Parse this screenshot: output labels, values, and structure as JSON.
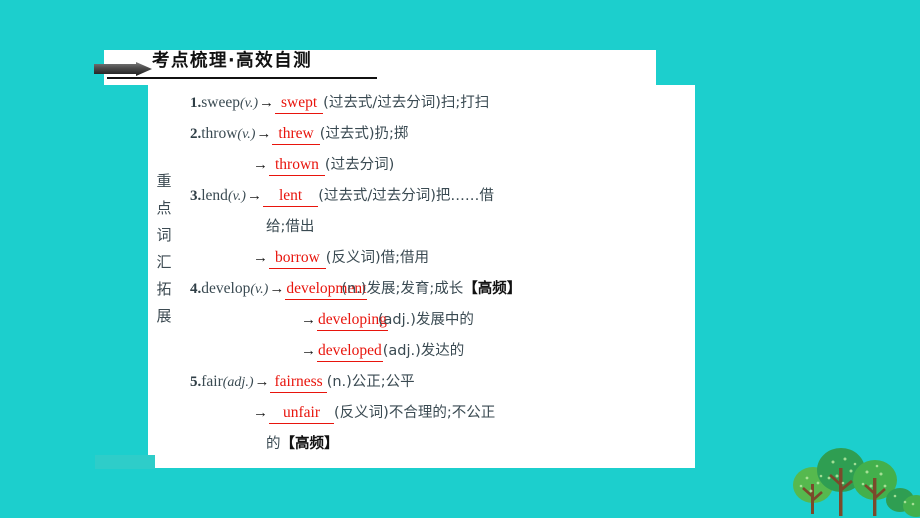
{
  "theme": {
    "teal": "#1ccfcd",
    "red": "#e8140c",
    "ink": "#3a4a52",
    "white": "#ffffff"
  },
  "header": {
    "title": "考点梳理·高效自测",
    "arrow_icon": "arrow-right-icon"
  },
  "sidebar": {
    "vertical_label": "重点词汇拓展",
    "chars": [
      "重",
      "点",
      "词",
      "汇",
      "拓",
      "展"
    ]
  },
  "entries": [
    {
      "num": "1.",
      "word": "sweep",
      "pos": "(v.)",
      "arrow": "→",
      "answer": "swept",
      "gloss": "(过去式/过去分词)扫;打扫"
    },
    {
      "num": "2.",
      "word": "throw",
      "pos": "(v.)",
      "arrow": "→",
      "answer": "threw",
      "gloss": "(过去式)扔;掷"
    },
    {
      "num": "",
      "word": "",
      "pos": "",
      "arrow": "→",
      "answer": "thrown",
      "gloss": "(过去分词)"
    },
    {
      "num": "3.",
      "word": "lend",
      "pos": "(v.)",
      "arrow": "→",
      "answer": "lent",
      "gloss": "(过去式/过去分词)把……借"
    },
    {
      "num": "",
      "word": "",
      "pos": "",
      "arrow": "",
      "answer": "",
      "gloss": "给;借出"
    },
    {
      "num": "",
      "word": "",
      "pos": "",
      "arrow": "→",
      "answer": "borrow",
      "gloss": "(反义词)借;借用"
    },
    {
      "num": "4.",
      "word": "develop",
      "pos": "(v.)",
      "arrow": "→",
      "answer": "development",
      "gloss": "(n.)发展;发育;成长",
      "tag": "【高频】"
    },
    {
      "num": "",
      "word": "",
      "pos": "",
      "arrow": "→",
      "answer": "developing",
      "gloss": "(adj.)发展中的"
    },
    {
      "num": "",
      "word": "",
      "pos": "",
      "arrow": "→",
      "answer": "developed",
      "gloss": "(adj.)发达的"
    },
    {
      "num": "5.",
      "word": "fair",
      "pos": "(adj.)",
      "arrow": "→",
      "answer": "fairness",
      "gloss": "(n.)公正;公平"
    },
    {
      "num": "",
      "word": "",
      "pos": "",
      "arrow": "→",
      "answer": "unfair",
      "gloss": "(反义词)不合理的;不公正"
    },
    {
      "num": "",
      "word": "",
      "pos": "",
      "arrow": "",
      "answer": "",
      "gloss": "的",
      "tag": "【高频】"
    }
  ],
  "decorations": {
    "trees_icon": "trees-icon",
    "tree_color_dark": "#2f9e52",
    "tree_color_light": "#56b94e",
    "trunk_color": "#7a4a2b"
  }
}
